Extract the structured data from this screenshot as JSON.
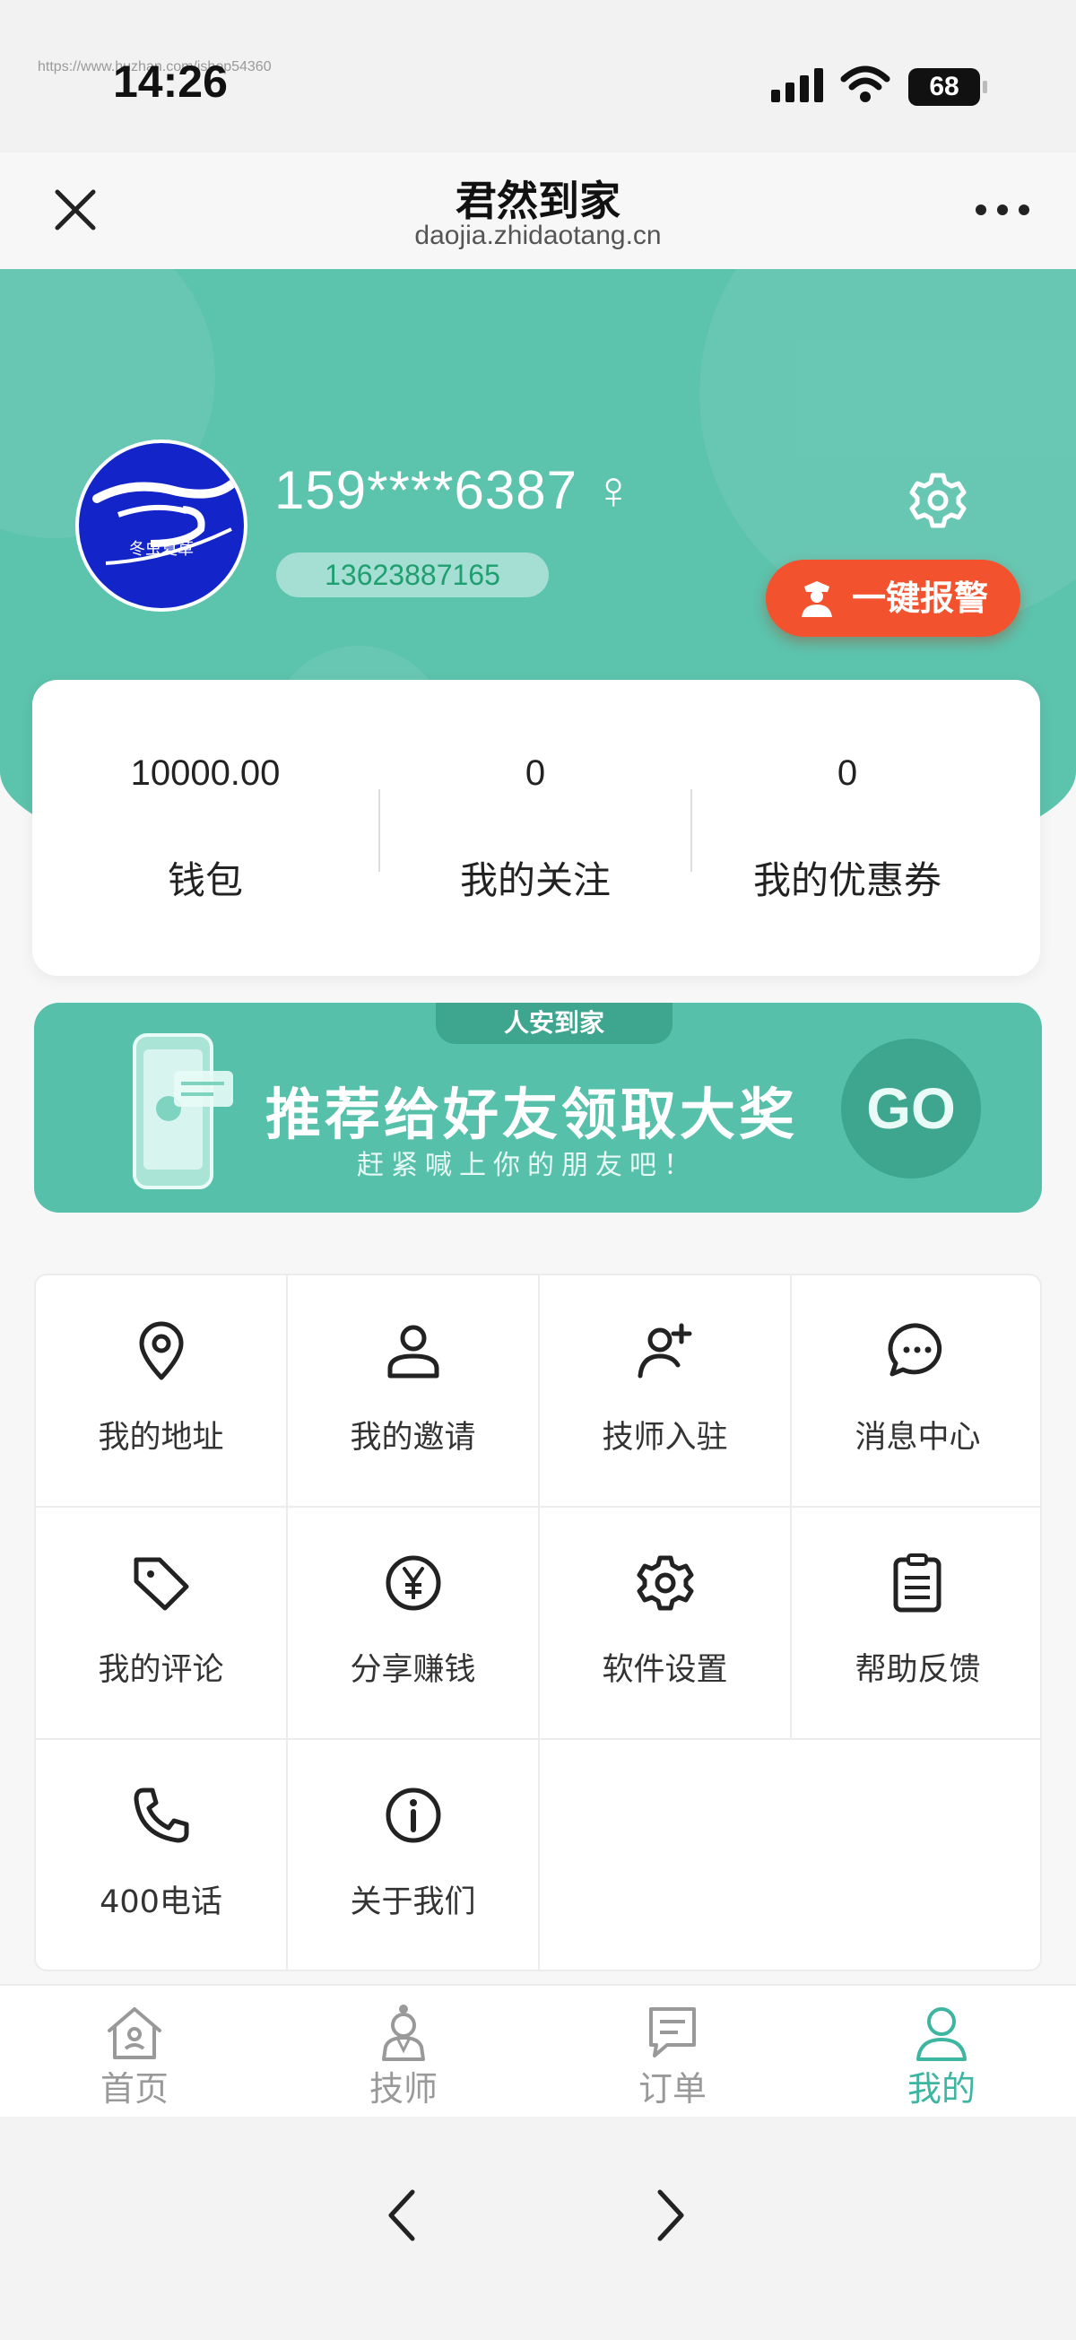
{
  "status": {
    "time": "14:26",
    "watermark": "https://www.huzhan.com/ishop54360",
    "battery": "68"
  },
  "nav": {
    "title": "君然到家",
    "domain": "daojia.zhidaotang.cn"
  },
  "profile": {
    "phone_masked": "159****6387 ♀",
    "phone": "13623887165",
    "avatar_caption": "冬虫夏草",
    "alarm_label": "一键报警"
  },
  "stats": [
    {
      "value": "10000.00",
      "label": "钱包"
    },
    {
      "value": "0",
      "label": "我的关注"
    },
    {
      "value": "0",
      "label": "我的优惠券"
    }
  ],
  "banner": {
    "tag": "人安到家",
    "title": "推荐给好友领取大奖",
    "subtitle": "赶紧喊上你的朋友吧！",
    "go": "GO"
  },
  "menu": [
    {
      "label": "我的地址",
      "icon": "location-pin-icon"
    },
    {
      "label": "我的邀请",
      "icon": "user-icon"
    },
    {
      "label": "技师入驻",
      "icon": "user-add-icon"
    },
    {
      "label": "消息中心",
      "icon": "chat-bubble-icon"
    },
    {
      "label": "我的评论",
      "icon": "tag-icon"
    },
    {
      "label": "分享赚钱",
      "icon": "yen-circle-icon"
    },
    {
      "label": "软件设置",
      "icon": "gear-icon"
    },
    {
      "label": "帮助反馈",
      "icon": "clipboard-icon"
    },
    {
      "label": "400电话",
      "icon": "phone-icon"
    },
    {
      "label": "关于我们",
      "icon": "info-circle-icon"
    }
  ],
  "tabs": [
    {
      "label": "首页",
      "icon": "home-icon"
    },
    {
      "label": "技师",
      "icon": "technician-icon"
    },
    {
      "label": "订单",
      "icon": "order-icon"
    },
    {
      "label": "我的",
      "icon": "profile-icon"
    }
  ],
  "colors": {
    "primary": "#5cc3ad",
    "alarm": "#f2522e",
    "tab_active": "#3db5a0"
  }
}
